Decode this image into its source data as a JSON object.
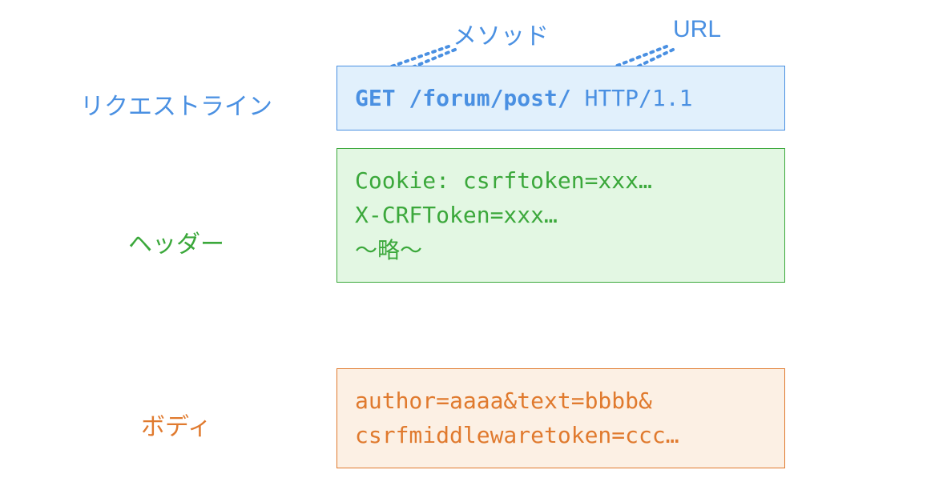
{
  "annotations": {
    "method": "メソッド",
    "url": "URL"
  },
  "sections": {
    "requestLine": {
      "label": "リクエストライン",
      "method_url": "GET /forum/post/",
      "http": " HTTP/1.1"
    },
    "header": {
      "label": "ヘッダー",
      "line1": "Cookie: csrftoken=xxx…",
      "line2": "X-CRFToken=xxx…",
      "line3": "〜略〜"
    },
    "body": {
      "label": "ボディ",
      "line1": "author=aaaa&text=bbbb&",
      "line2": "csrfmiddlewaretoken=ccc…"
    }
  },
  "colors": {
    "request": "#4A90E2",
    "header": "#3BA83B",
    "body": "#E07A2E"
  }
}
